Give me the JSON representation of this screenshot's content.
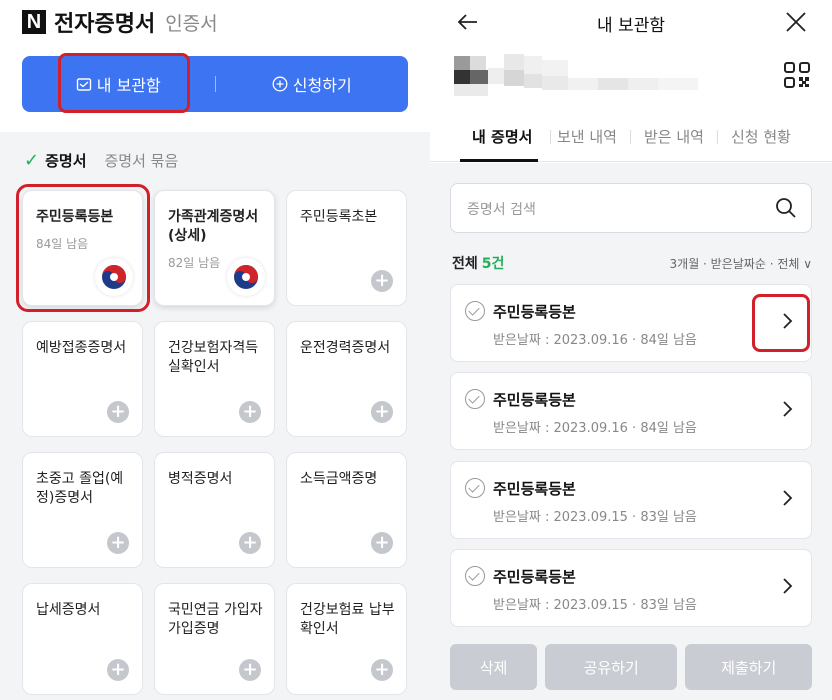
{
  "left": {
    "brand": {
      "logo_letter": "N",
      "title": "전자증명서",
      "subtitle": "인증서"
    },
    "actions": {
      "my_box": "내 보관함",
      "apply": "신청하기"
    },
    "segments": {
      "active": "증명서",
      "inactive": "증명서 묶음"
    },
    "cards": [
      {
        "title": "주민등록등본",
        "days": "84일 남음",
        "owned": true
      },
      {
        "title": "가족관계증명서(상세)",
        "days": "82일 남음",
        "owned": true
      },
      {
        "title": "주민등록초본",
        "days": "",
        "owned": false
      },
      {
        "title": "예방접종증명서",
        "days": "",
        "owned": false
      },
      {
        "title": "건강보험자격득실확인서",
        "days": "",
        "owned": false
      },
      {
        "title": "운전경력증명서",
        "days": "",
        "owned": false
      },
      {
        "title": "초중고 졸업(예정)증명서",
        "days": "",
        "owned": false
      },
      {
        "title": "병적증명서",
        "days": "",
        "owned": false
      },
      {
        "title": "소득금액증명",
        "days": "",
        "owned": false
      },
      {
        "title": "납세증명서",
        "days": "",
        "owned": false
      },
      {
        "title": "국민연금 가입자 가입증명",
        "days": "",
        "owned": false
      },
      {
        "title": "건강보험료 납부확인서",
        "days": "",
        "owned": false
      }
    ]
  },
  "right": {
    "header": {
      "title": "내 보관함"
    },
    "tabs": [
      "내 증명서",
      "보낸 내역",
      "받은 내역",
      "신청 현황"
    ],
    "search": {
      "placeholder": "증명서 검색"
    },
    "count": {
      "label": "전체",
      "value": "5건",
      "filter": "3개월 · 받은날짜순 · 전체 ∨"
    },
    "documents": [
      {
        "title": "주민등록등본",
        "meta": "받은날짜 : 2023.09.16 · 84일 남음"
      },
      {
        "title": "주민등록등본",
        "meta": "받은날짜 : 2023.09.16 · 84일 남음"
      },
      {
        "title": "주민등록등본",
        "meta": "받은날짜 : 2023.09.15 · 83일 남음"
      },
      {
        "title": "주민등록등본",
        "meta": "받은날짜 : 2023.09.15 · 83일 남음"
      }
    ],
    "buttons": {
      "delete": "삭제",
      "share": "공유하기",
      "submit": "제출하기"
    }
  },
  "colors": {
    "accent": "#3d74f2",
    "highlight": "#d1202a",
    "green": "#20b05a"
  }
}
